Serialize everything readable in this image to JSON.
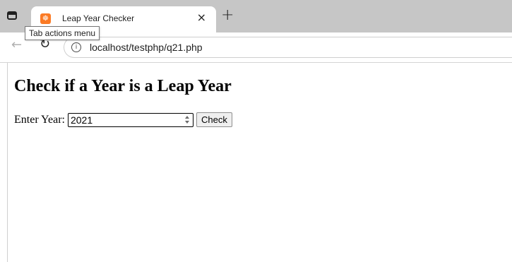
{
  "browser": {
    "tab": {
      "title": "Leap Year Checker",
      "favicon_glyph": "☸",
      "close_glyph": "×"
    },
    "new_tab_glyph": "+",
    "tooltip": "Tab actions menu",
    "nav": {
      "back_glyph": "←",
      "reload_glyph": "↻",
      "info_glyph": "i"
    },
    "url": "localhost/testphp/q21.php"
  },
  "page": {
    "title": "Check if a Year is a Leap Year",
    "form": {
      "label": "Enter Year:",
      "year_value": "2021",
      "check_button": "Check"
    }
  },
  "colors": {
    "tabstrip_bg": "#c6c6c6",
    "favicon": "#fb7a24"
  }
}
